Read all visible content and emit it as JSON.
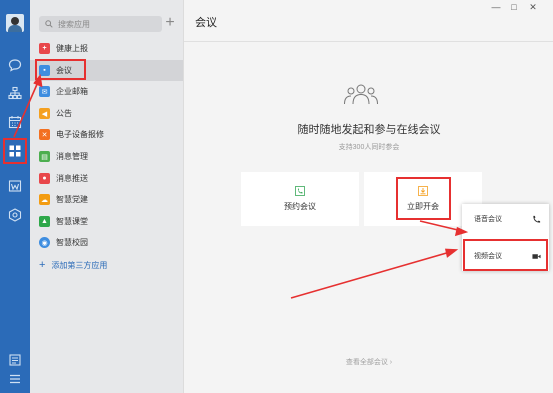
{
  "search": {
    "placeholder": "搜索应用"
  },
  "apps": [
    {
      "label": "健康上报",
      "color": "#e8474b",
      "glyph": "+"
    },
    {
      "label": "会议",
      "color": "#3e8de0",
      "glyph": "▪"
    },
    {
      "label": "企业邮箱",
      "color": "#3e8de0",
      "glyph": "✉"
    },
    {
      "label": "公告",
      "color": "#f4a020",
      "glyph": "◀"
    },
    {
      "label": "电子设备报修",
      "color": "#f37021",
      "glyph": "✕"
    },
    {
      "label": "消息管理",
      "color": "#4cae4f",
      "glyph": "▤"
    },
    {
      "label": "消息推送",
      "color": "#e8474b",
      "glyph": "●"
    },
    {
      "label": "智慧党建",
      "color": "#f39c12",
      "glyph": "☁"
    },
    {
      "label": "智慧课堂",
      "color": "#2ea84a",
      "glyph": "▲"
    },
    {
      "label": "智慧校园",
      "color": "#3e8de0",
      "glyph": "◉"
    }
  ],
  "add_third_party": "添加第三方应用",
  "main": {
    "title": "会议",
    "headline": "随时随地发起和参与在线会议",
    "subline": "支持300人同时参会",
    "cards": [
      {
        "label": "预约会议",
        "icon": "phone-icon"
      },
      {
        "label": "立即开会",
        "icon": "download-icon"
      }
    ],
    "view_all": "查看全部会议 ›"
  },
  "popup": {
    "items": [
      {
        "label": "语音会议",
        "icon": "phone-icon"
      },
      {
        "label": "视频会议",
        "icon": "video-camera-icon"
      }
    ]
  },
  "window_controls": {
    "minimize": "—",
    "maximize": "□",
    "close": "✕"
  },
  "colors": {
    "rail": "#2b6bb8",
    "accent": "#2b6bb8",
    "annotation": "#e63030",
    "selected": "#d3d4d7"
  }
}
